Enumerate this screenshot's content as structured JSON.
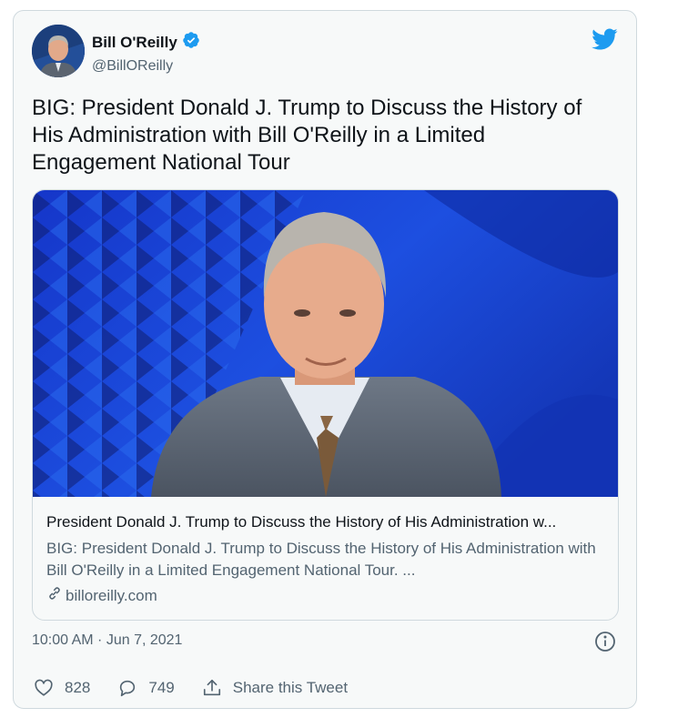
{
  "author": {
    "name": "Bill O'Reilly",
    "handle": "@BillOReilly",
    "verified": true
  },
  "tweet": {
    "text": "BIG: President Donald J. Trump to Discuss the History of His Administration with Bill O'Reilly in a Limited Engagement National Tour",
    "timestamp": "10:00 AM · Jun 7, 2021"
  },
  "card": {
    "title": "President Donald J. Trump to Discuss the History of His Administration w...",
    "description": "BIG: President Donald J. Trump to Discuss the History of His Administration with Bill O'Reilly in a Limited Engagement National Tour. ...",
    "domain": "billoreilly.com"
  },
  "actions": {
    "likes": "828",
    "replies": "749",
    "share_label": "Share this Tweet"
  },
  "icons": {
    "logo": "twitter-bird-icon",
    "verified": "verified-badge-icon",
    "link": "link-icon",
    "info": "info-icon",
    "like": "heart-icon",
    "reply": "reply-icon",
    "share": "share-icon"
  },
  "colors": {
    "twitter_blue": "#1d9bf0",
    "text_primary": "#0f1419",
    "text_secondary": "#536471",
    "border": "#cfd9de",
    "background": "#f7f9f9"
  }
}
